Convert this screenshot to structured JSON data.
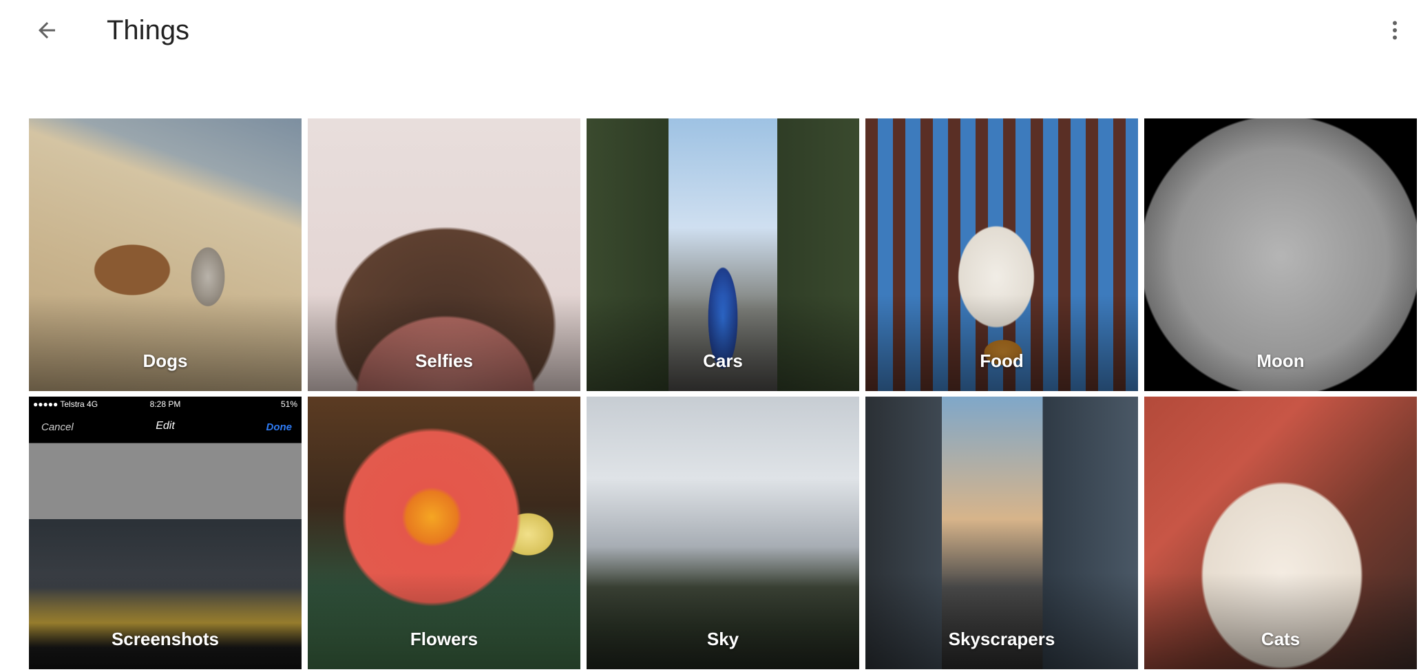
{
  "header": {
    "title": "Things",
    "back_icon": "arrow-back-icon",
    "more_icon": "more-vert-icon"
  },
  "colors": {
    "background": "#ffffff",
    "title_text": "#222222",
    "icon": "#616161",
    "label_text": "#ffffff"
  },
  "tiles": [
    {
      "label": "Dogs"
    },
    {
      "label": "Selfies"
    },
    {
      "label": "Cars"
    },
    {
      "label": "Food"
    },
    {
      "label": "Moon"
    },
    {
      "label": "Screenshots"
    },
    {
      "label": "Flowers"
    },
    {
      "label": "Sky"
    },
    {
      "label": "Skyscrapers"
    },
    {
      "label": "Cats"
    }
  ],
  "screenshot_thumb": {
    "carrier": "●●●●● Telstra  4G",
    "time": "8:28 PM",
    "battery": "51%",
    "cancel": "Cancel",
    "edit": "Edit",
    "done": "Done"
  }
}
